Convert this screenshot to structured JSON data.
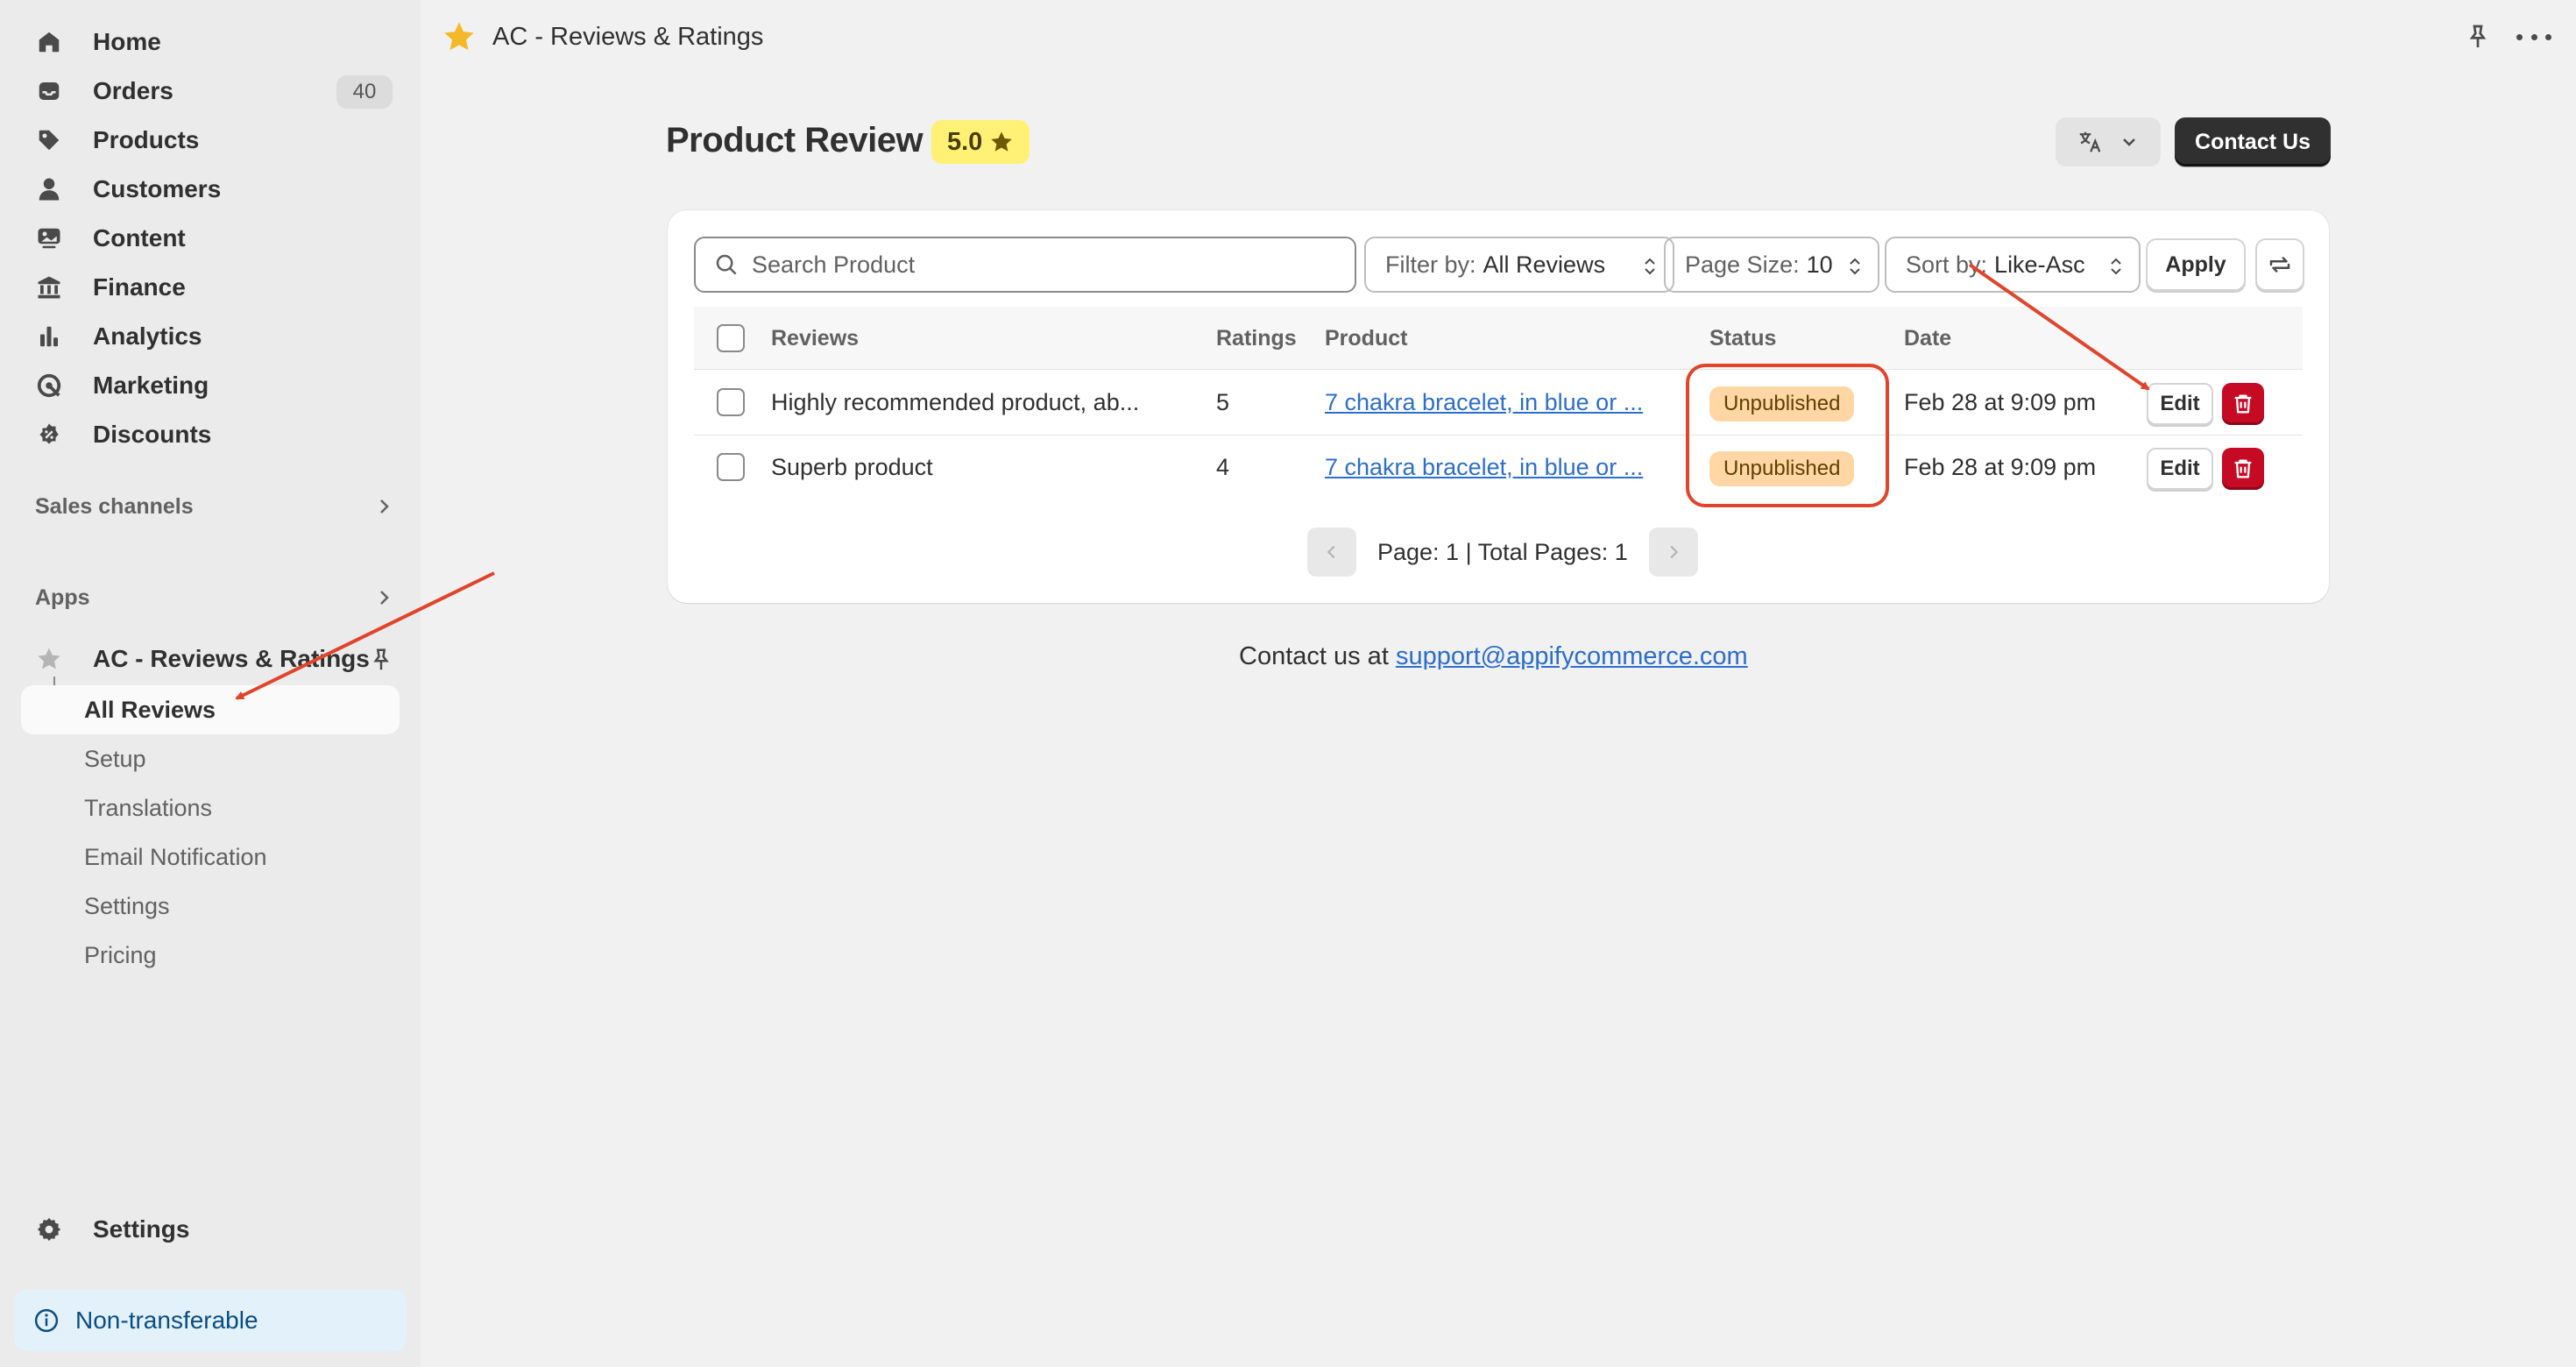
{
  "sidebar": {
    "nav": [
      {
        "label": "Home",
        "icon": "home-icon"
      },
      {
        "label": "Orders",
        "icon": "inbox-icon",
        "count": "40"
      },
      {
        "label": "Products",
        "icon": "tag-icon"
      },
      {
        "label": "Customers",
        "icon": "person-icon"
      },
      {
        "label": "Content",
        "icon": "image-icon"
      },
      {
        "label": "Finance",
        "icon": "bank-icon"
      },
      {
        "label": "Analytics",
        "icon": "bar-chart-icon"
      },
      {
        "label": "Marketing",
        "icon": "target-icon"
      },
      {
        "label": "Discounts",
        "icon": "discount-icon"
      }
    ],
    "sales_channels_label": "Sales channels",
    "apps_label": "Apps",
    "app_name": "AC - Reviews & Ratings",
    "app_subitems": [
      {
        "label": "All Reviews",
        "active": true
      },
      {
        "label": "Setup"
      },
      {
        "label": "Translations"
      },
      {
        "label": "Email Notification"
      },
      {
        "label": "Settings"
      },
      {
        "label": "Pricing"
      }
    ],
    "settings_label": "Settings",
    "banner_label": "Non-transferable"
  },
  "topbar": {
    "title": "AC - Reviews & Ratings"
  },
  "page": {
    "title": "Product Review",
    "rating": "5.0",
    "contact_button": "Contact Us"
  },
  "toolbar": {
    "search_placeholder": "Search Product",
    "filter_label": "Filter by:",
    "filter_value": "All Reviews",
    "page_size_label": "Page Size:",
    "page_size_value": "10",
    "sort_label": "Sort by:",
    "sort_value": "Like-Asc",
    "apply_label": "Apply"
  },
  "table": {
    "headers": {
      "reviews": "Reviews",
      "ratings": "Ratings",
      "product": "Product",
      "status": "Status",
      "date": "Date"
    },
    "rows": [
      {
        "review": "Highly recommended product, ab...",
        "rating": "5",
        "product": "7 chakra bracelet, in blue or ...",
        "status": "Unpublished",
        "date": "Feb 28 at 9:09 pm",
        "edit": "Edit"
      },
      {
        "review": "Superb product",
        "rating": "4",
        "product": "7 chakra bracelet, in blue or ...",
        "status": "Unpublished",
        "date": "Feb 28 at 9:09 pm",
        "edit": "Edit"
      }
    ],
    "pagination": "Page: 1 | Total Pages: 1"
  },
  "footer": {
    "contact_prefix": "Contact us at",
    "email": "support@appifycommerce.com"
  },
  "colors": {
    "accent_link": "#2c6ecb",
    "status_unpublished_bg": "#ffd6a4",
    "delete_red": "#c70a24",
    "rating_badge_bg": "#fff176",
    "annotation_red": "#e0452b"
  }
}
